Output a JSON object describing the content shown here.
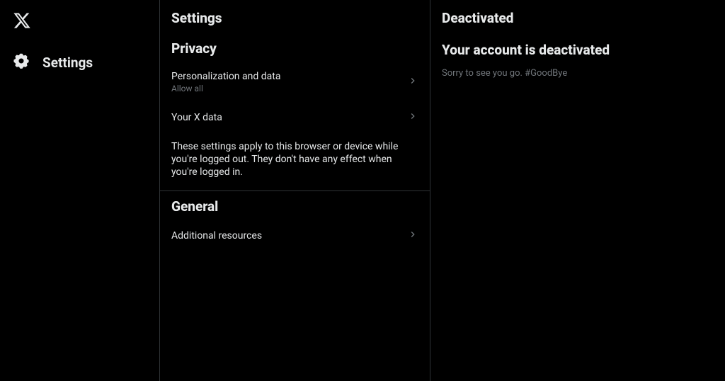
{
  "sidebar": {
    "settings_label": "Settings"
  },
  "settings": {
    "header": "Settings",
    "privacy": {
      "heading": "Privacy",
      "personalization": {
        "label": "Personalization and data",
        "sublabel": "Allow all"
      },
      "your_x_data": {
        "label": "Your X data"
      },
      "explain": "These settings apply to this browser or device while you're logged out. They don't have any effect when you're logged in."
    },
    "general": {
      "heading": "General",
      "additional_resources": {
        "label": "Additional resources"
      }
    }
  },
  "detail": {
    "title": "Deactivated",
    "subtitle": "Your account is deactivated",
    "body": "Sorry to see you go. #GoodBye"
  }
}
